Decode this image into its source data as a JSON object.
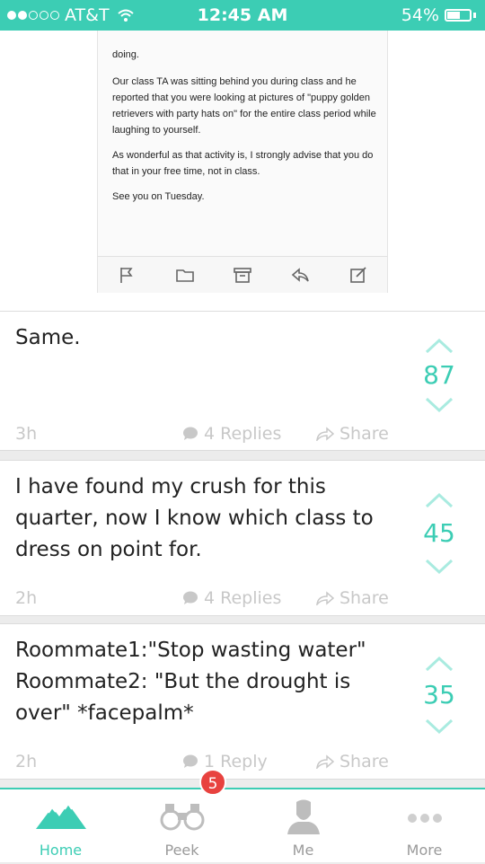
{
  "status_bar": {
    "carrier": "AT&T",
    "time": "12:45 AM",
    "battery": "54%"
  },
  "email": {
    "partial_line": "doing.",
    "paragraphs": [
      "Our class TA was sitting behind you during class and he reported that you were looking at pictures of \"puppy golden retrievers with party hats on\" for the entire class period while laughing to yourself.",
      "As wonderful as that activity is, I strongly advise that you do that in your free time, not in class.",
      "See you on Tuesday."
    ],
    "toolbar_icons": [
      "flag-icon",
      "folder-icon",
      "archive-icon",
      "reply-icon",
      "compose-icon"
    ]
  },
  "posts": [
    {
      "text": "Same.",
      "votes": "87",
      "time": "3h",
      "replies": "4 Replies",
      "share": "Share"
    },
    {
      "text": "I have found my crush for this quarter, now I know which class to dress on point for.",
      "votes": "45",
      "time": "2h",
      "replies": "4 Replies",
      "share": "Share"
    },
    {
      "text": "Roommate1:\"Stop wasting water\" Roommate2:  \"But the drought is over\" *facepalm*",
      "votes": "35",
      "time": "2h",
      "replies": "1 Reply",
      "share": "Share"
    }
  ],
  "tabs": [
    {
      "label": "Home",
      "icon": "mountain-icon",
      "active": true
    },
    {
      "label": "Peek",
      "icon": "binoculars-icon",
      "badge": "5"
    },
    {
      "label": "Me",
      "icon": "person-icon"
    },
    {
      "label": "More",
      "icon": "dots-icon"
    }
  ],
  "colors": {
    "accent": "#3ccdb4",
    "badge": "#e8423f",
    "muted": "#c8c8c8"
  }
}
